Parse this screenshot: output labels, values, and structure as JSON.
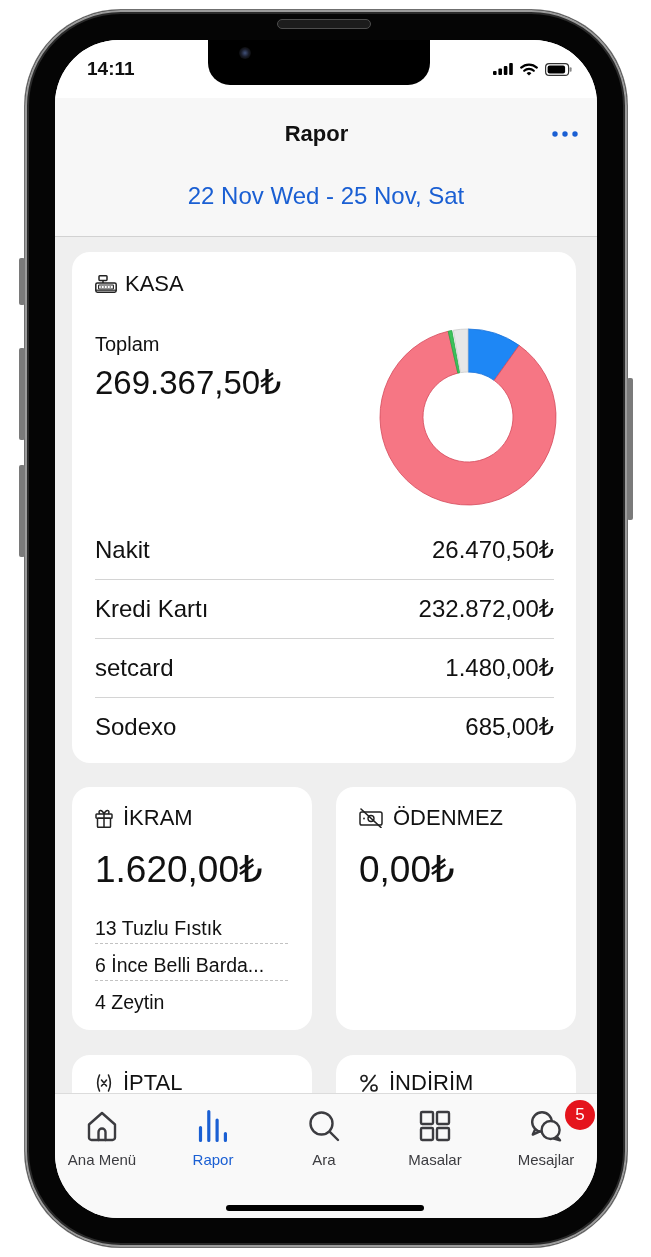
{
  "status_bar": {
    "time": "14:11"
  },
  "header": {
    "title": "Rapor",
    "date_range": "22 Nov Wed - 25 Nov, Sat"
  },
  "kasa": {
    "title": "KASA",
    "total_label": "Toplam",
    "total": "269.367,50₺",
    "payments": [
      {
        "name": "Nakit",
        "amount": "26.470,50₺"
      },
      {
        "name": "Kredi Kartı",
        "amount": "232.872,00₺"
      },
      {
        "name": "setcard",
        "amount": "1.480,00₺"
      },
      {
        "name": "Sodexo",
        "amount": "685,00₺"
      }
    ]
  },
  "summary_cards": [
    {
      "kind": "ikram",
      "title": "İKRAM",
      "amount": "1.620,00₺",
      "items": [
        "13 Tuzlu Fıstık",
        "6 İnce Belli Barda...",
        "4 Zeytin"
      ]
    },
    {
      "kind": "odenmez",
      "title": "ÖDENMEZ",
      "amount": "0,00₺"
    },
    {
      "kind": "iptal",
      "title": "İPTAL"
    },
    {
      "kind": "indirim",
      "title": "İNDİRİM"
    }
  ],
  "tab_bar": {
    "tabs": [
      {
        "kind": "home",
        "label": "Ana Menü",
        "selected": false
      },
      {
        "kind": "report",
        "label": "Rapor",
        "selected": true
      },
      {
        "kind": "search",
        "label": "Ara",
        "selected": false
      },
      {
        "kind": "tables",
        "label": "Masalar",
        "selected": false
      },
      {
        "kind": "messages",
        "label": "Mesajlar",
        "selected": false,
        "badge": "5"
      }
    ]
  }
}
